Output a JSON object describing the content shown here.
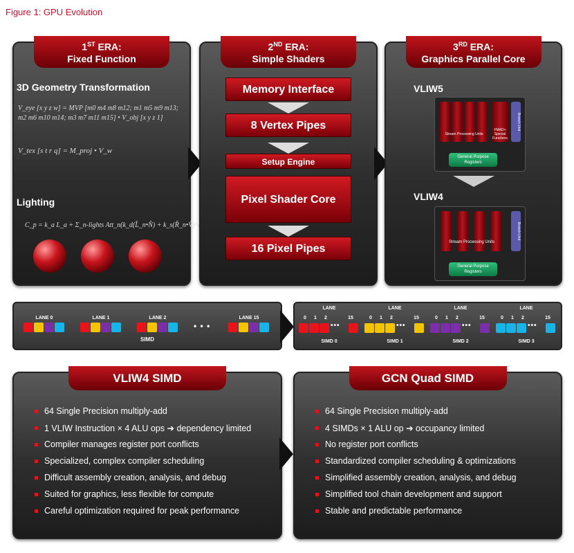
{
  "figure_title": "Figure 1: GPU Evolution",
  "eras": [
    {
      "num": "1",
      "sup": "ST",
      "label": "ERA:",
      "name": "Fixed Function"
    },
    {
      "num": "2",
      "sup": "ND",
      "label": "ERA:",
      "name": "Simple Shaders"
    },
    {
      "num": "3",
      "sup": "RD",
      "label": "ERA:",
      "name": "Graphics Parallel Core"
    }
  ],
  "era1": {
    "geometry_heading": "3D Geometry Transformation",
    "eq1": "V_eye [x y z w] = MVP [m0 m4 m8 m12; m1 m5 m9 m13; m2 m6 m10 m14; m3 m7 m11 m15] • V_obj [x y z 1]",
    "eq2": "V_tex [s t r q] = M_proj • V_w",
    "lighting_heading": "Lighting",
    "eq3": "C_p = k_a L_a + Σ_n-lights Att_n(k_d(L̂_n•N̂) + k_s(R̂_n•V̂)^α)"
  },
  "era2": {
    "blocks": [
      "Memory Interface",
      "8 Vertex Pipes",
      "Setup Engine",
      "Pixel Shader Core",
      "16 Pixel Pipes"
    ]
  },
  "era3": {
    "vliw5": "VLIW5",
    "vliw4": "VLIW4",
    "stream": "Stream Processing Units",
    "fmad": "FMAD+ Special Functions",
    "branch": "Branch Unit",
    "gpr": "General Purpose Registers"
  },
  "simd_left": {
    "lanes": [
      "LANE 0",
      "LANE 1",
      "LANE 2",
      "LANE 15"
    ],
    "label": "SIMD",
    "dots": "• • •"
  },
  "simd_right": {
    "lane": "LANE",
    "idx": [
      "0",
      "1",
      "2",
      "15"
    ],
    "dots": "•••",
    "simds": [
      "SIMD 0",
      "SIMD 1",
      "SIMD 2",
      "SIMD 3"
    ]
  },
  "colors": {
    "red": "#e8141c",
    "yellow": "#f5c400",
    "purple": "#7a2fa8",
    "cyan": "#18b4e8"
  },
  "vliw4_simd": {
    "title": "VLIW4 SIMD",
    "bullets": [
      "64 Single Precision multiply-add",
      "1 VLIW Instruction × 4 ALU ops ➔ dependency limited",
      "Compiler manages register port conflicts",
      "Specialized, complex compiler scheduling",
      "Difficult assembly creation, analysis, and debug",
      "Suited for graphics, less flexible for compute",
      "Careful optimization required for peak performance"
    ]
  },
  "gcn_simd": {
    "title": "GCN Quad SIMD",
    "bullets": [
      "64 Single Precision multiply-add",
      "4 SIMDs × 1 ALU op ➔ occupancy limited",
      "No register port conflicts",
      "Standardized compiler scheduling & optimizations",
      "Simplified assembly creation, analysis, and debug",
      "Simplified tool chain development and support",
      "Stable and predictable performance"
    ]
  }
}
